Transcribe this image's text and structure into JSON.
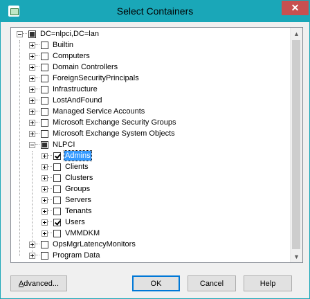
{
  "window": {
    "title": "Select Containers",
    "close_symbol": "✕"
  },
  "tree": {
    "root": {
      "label": "DC=nlpci,DC=lan",
      "state": "indeterminate"
    },
    "items": [
      {
        "label": "Builtin",
        "checked": false
      },
      {
        "label": "Computers",
        "checked": false
      },
      {
        "label": "Domain Controllers",
        "checked": false
      },
      {
        "label": "ForeignSecurityPrincipals",
        "checked": false
      },
      {
        "label": "Infrastructure",
        "checked": false
      },
      {
        "label": "LostAndFound",
        "checked": false
      },
      {
        "label": "Managed Service Accounts",
        "checked": false
      },
      {
        "label": "Microsoft Exchange Security Groups",
        "checked": false
      },
      {
        "label": "Microsoft Exchange System Objects",
        "checked": false
      },
      {
        "label": "NLPCI",
        "state": "indeterminate",
        "expanded": true
      },
      {
        "label": "OpsMgrLatencyMonitors",
        "checked": false
      },
      {
        "label": "Program Data",
        "checked": false
      }
    ],
    "nlpci_children": [
      {
        "label": "Admins",
        "checked": true,
        "selected": true
      },
      {
        "label": "Clients",
        "checked": false
      },
      {
        "label": "Clusters",
        "checked": false
      },
      {
        "label": "Groups",
        "checked": false
      },
      {
        "label": "Servers",
        "checked": false
      },
      {
        "label": "Tenants",
        "checked": false
      },
      {
        "label": "Users",
        "checked": true
      },
      {
        "label": "VMMDKM",
        "checked": false
      }
    ]
  },
  "scrollbar": {
    "up_symbol": "▲",
    "down_symbol": "▼"
  },
  "buttons": {
    "advanced": {
      "prefix": "A",
      "rest": "dvanced..."
    },
    "ok": "OK",
    "cancel": "Cancel",
    "help": "Help"
  },
  "colors": {
    "titlebar": "#1aa7b8",
    "close": "#c75050",
    "selection": "#3399ff"
  }
}
